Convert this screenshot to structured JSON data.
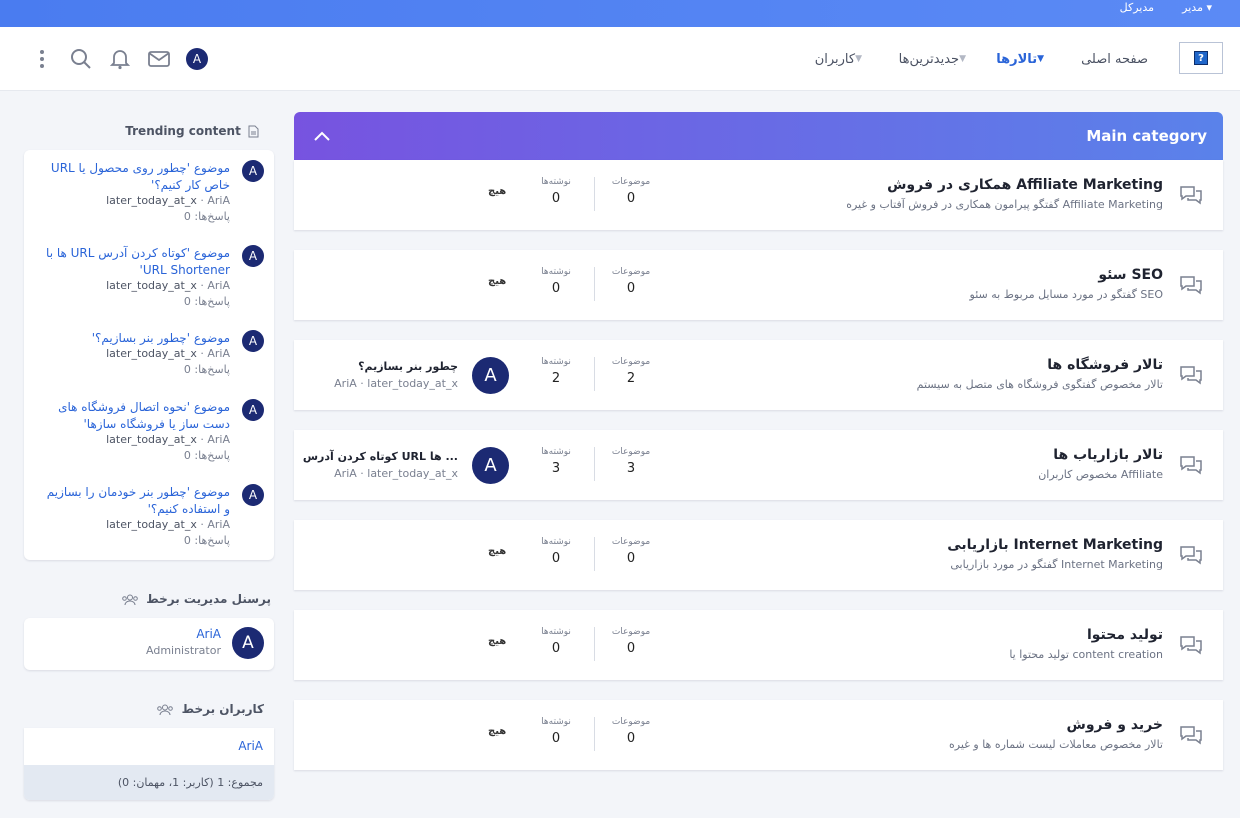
{
  "topbar": {
    "user": "مدیرکل",
    "admin": "مدیر ▾"
  },
  "header": {
    "logo_glyph": "?",
    "nav": {
      "home": "صفحه اصلی",
      "forums": "تالارها",
      "new": "جدیدترین‌ها",
      "users": "کاربران"
    },
    "avatar_letter": "A"
  },
  "main": {
    "category_title": "Main category",
    "labels": {
      "topics": "موضوعات",
      "posts": "نوشته‌ها",
      "none": "هیچ"
    },
    "forums": [
      {
        "name": "همکاری در فروش Affiliate Marketing",
        "desc": "گفتگو پیرامون همکاری در فروش آفتاب و غیره Affiliate Marketing",
        "topics": "0",
        "posts": "0",
        "last": null
      },
      {
        "name": "سئو SEO",
        "desc": "گفتگو در مورد مسایل مربوط به سئو SEO",
        "topics": "0",
        "posts": "0",
        "last": null
      },
      {
        "name": "تالار فروشگاه ها",
        "desc": "تالار مخصوص گفتگوی فروشگاه های متصل به سیستم",
        "topics": "2",
        "posts": "2",
        "last": {
          "avatar": "A",
          "title": "چطور بنر بسازیم؟",
          "meta": "AriA · later_today_at_x"
        }
      },
      {
        "name": "تالار بازاریاب ها",
        "desc": "مخصوص کاربران Affiliate",
        "topics": "3",
        "posts": "3",
        "last": {
          "avatar": "A",
          "title": "کوتاه کردن آدرس URL ها ...",
          "meta": "AriA · later_today_at_x"
        }
      },
      {
        "name": "بازاریابی Internet Marketing",
        "desc": "گفتگو در مورد بازاریابی Internet Marketing",
        "topics": "0",
        "posts": "0",
        "last": null
      },
      {
        "name": "تولید محتوا",
        "desc": "تولید محتوا یا content creation",
        "topics": "0",
        "posts": "0",
        "last": null
      },
      {
        "name": "خرید و فروش",
        "desc": "تالار مخصوص معاملات لیست شماره ها و غیره",
        "topics": "0",
        "posts": "0",
        "last": null
      }
    ]
  },
  "sidebar": {
    "trending_title": "Trending content",
    "trending": [
      {
        "avatar": "A",
        "title": "موضوع 'چطور روی محصول یا URL خاص کار کنیم؟'",
        "author": "AriA",
        "when": "later_today_at_x",
        "replies": "پاسخ‌ها: 0"
      },
      {
        "avatar": "A",
        "title": "موضوع 'کوتاه کردن آدرس URL ها با URL Shortener'",
        "author": "AriA",
        "when": "later_today_at_x",
        "replies": "پاسخ‌ها: 0"
      },
      {
        "avatar": "A",
        "title": "موضوع 'چطور بنر بسازیم؟'",
        "author": "AriA",
        "when": "later_today_at_x",
        "replies": "پاسخ‌ها: 0"
      },
      {
        "avatar": "A",
        "title": "موضوع 'نحوه اتصال فروشگاه های دست ساز یا فروشگاه سازها'",
        "author": "AriA",
        "when": "later_today_at_x",
        "replies": "پاسخ‌ها: 0"
      },
      {
        "avatar": "A",
        "title": "موضوع 'چطور بنر خودمان را بسازیم و استفاده کنیم؟'",
        "author": "AriA",
        "when": "later_today_at_x",
        "replies": "پاسخ‌ها: 0"
      }
    ],
    "staff_title": "پرسنل مدیریت برخط",
    "staff": {
      "avatar": "A",
      "name": "AriA",
      "role": "Administrator"
    },
    "online_title": "کاربران برخط",
    "online": {
      "name": "AriA",
      "summary": "مجموع: 1 (کاربر: 1، مهمان: 0)"
    }
  }
}
